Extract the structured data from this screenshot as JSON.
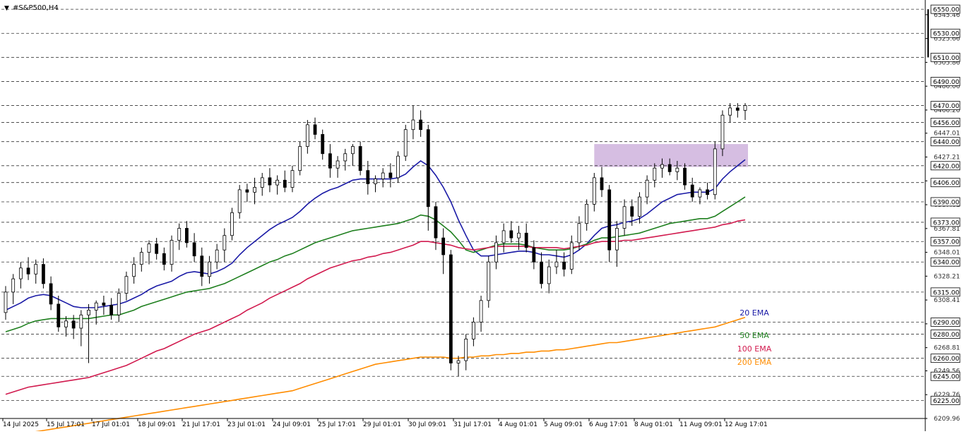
{
  "window": {
    "title": "#S&P500,H4",
    "title_icon": "triangle-down-icon"
  },
  "chart_data": {
    "type": "candlestick",
    "symbol": "#S&P500",
    "timeframe": "H4",
    "ylim": [
      6209.96,
      6553
    ],
    "price_labels_boxed": [
      6550.0,
      6530.0,
      6510.0,
      6490.0,
      6470.0,
      6456.0,
      6440.0,
      6420.0,
      6406.0,
      6390.0,
      6373.0,
      6357.0,
      6340.0,
      6315.0,
      6290.0,
      6280.0,
      6260.0,
      6245.0,
      6225.0
    ],
    "price_labels_plain": [
      "6545.46",
      "6525.66",
      "6505.86",
      "6486.06",
      "6466.26",
      "6447.01",
      "6427.21",
      "6407.41",
      "6387.61",
      "6367.81",
      "6348.01",
      "6328.21",
      "6308.41",
      "6288.61",
      "6268.81",
      "6249.56",
      "6229.76",
      "6209.96"
    ],
    "level_lines": [
      6550,
      6530,
      6510,
      6490,
      6470,
      6456,
      6440,
      6420,
      6406,
      6390,
      6373,
      6357,
      6340,
      6315,
      6290,
      6280,
      6260,
      6245,
      6225
    ],
    "x_labels": [
      "14 Jul 2025",
      "15 Jul 17:01",
      "17 Jul 01:01",
      "18 Jul 09:01",
      "21 Jul 17:01",
      "23 Jul 01:01",
      "24 Jul 09:01",
      "25 Jul 17:01",
      "29 Jul 01:01",
      "30 Jul 09:01",
      "31 Jul 17:01",
      "4 Aug 01:01",
      "5 Aug 09:01",
      "6 Aug 17:01",
      "8 Aug 01:01",
      "11 Aug 09:01",
      "12 Aug 17:01"
    ],
    "candles": [
      [
        6298,
        6320,
        6292,
        6315
      ],
      [
        6315,
        6330,
        6305,
        6326
      ],
      [
        6326,
        6340,
        6318,
        6335
      ],
      [
        6335,
        6344,
        6325,
        6330
      ],
      [
        6330,
        6342,
        6322,
        6338
      ],
      [
        6338,
        6343,
        6318,
        6322
      ],
      [
        6322,
        6328,
        6300,
        6305
      ],
      [
        6305,
        6312,
        6282,
        6286
      ],
      [
        6286,
        6295,
        6278,
        6291
      ],
      [
        6291,
        6296,
        6276,
        6285
      ],
      [
        6285,
        6300,
        6270,
        6296
      ],
      [
        6296,
        6305,
        6256,
        6300
      ],
      [
        6300,
        6308,
        6288,
        6306
      ],
      [
        6306,
        6312,
        6296,
        6304
      ],
      [
        6304,
        6310,
        6292,
        6296
      ],
      [
        6296,
        6318,
        6290,
        6314
      ],
      [
        6314,
        6332,
        6308,
        6328
      ],
      [
        6328,
        6344,
        6322,
        6338
      ],
      [
        6338,
        6352,
        6332,
        6348
      ],
      [
        6348,
        6358,
        6338,
        6355
      ],
      [
        6355,
        6360,
        6342,
        6347
      ],
      [
        6347,
        6352,
        6333,
        6338
      ],
      [
        6338,
        6362,
        6332,
        6358
      ],
      [
        6358,
        6372,
        6350,
        6368
      ],
      [
        6368,
        6374,
        6352,
        6356
      ],
      [
        6356,
        6364,
        6340,
        6345
      ],
      [
        6345,
        6352,
        6320,
        6328
      ],
      [
        6328,
        6345,
        6322,
        6340
      ],
      [
        6340,
        6355,
        6334,
        6350
      ],
      [
        6350,
        6368,
        6340,
        6362
      ],
      [
        6362,
        6385,
        6358,
        6381
      ],
      [
        6381,
        6404,
        6376,
        6400
      ],
      [
        6400,
        6405,
        6390,
        6398
      ],
      [
        6398,
        6410,
        6388,
        6402
      ],
      [
        6402,
        6414,
        6395,
        6410
      ],
      [
        6410,
        6418,
        6398,
        6404
      ],
      [
        6404,
        6412,
        6396,
        6408
      ],
      [
        6408,
        6416,
        6398,
        6402
      ],
      [
        6402,
        6420,
        6398,
        6416
      ],
      [
        6416,
        6440,
        6412,
        6436
      ],
      [
        6436,
        6458,
        6430,
        6454
      ],
      [
        6454,
        6460,
        6442,
        6446
      ],
      [
        6446,
        6450,
        6425,
        6430
      ],
      [
        6430,
        6438,
        6410,
        6418
      ],
      [
        6418,
        6428,
        6410,
        6424
      ],
      [
        6424,
        6434,
        6416,
        6430
      ],
      [
        6430,
        6438,
        6420,
        6436
      ],
      [
        6436,
        6440,
        6412,
        6416
      ],
      [
        6416,
        6424,
        6396,
        6405
      ],
      [
        6405,
        6412,
        6398,
        6409
      ],
      [
        6409,
        6418,
        6402,
        6414
      ],
      [
        6414,
        6422,
        6402,
        6410
      ],
      [
        6410,
        6432,
        6406,
        6428
      ],
      [
        6428,
        6454,
        6424,
        6450
      ],
      [
        6450,
        6470,
        6442,
        6458
      ],
      [
        6458,
        6466,
        6444,
        6450
      ],
      [
        6450,
        6454,
        6366,
        6386
      ],
      [
        6386,
        6390,
        6350,
        6360
      ],
      [
        6360,
        6368,
        6330,
        6346
      ],
      [
        6346,
        6350,
        6250,
        6256
      ],
      [
        6256,
        6262,
        6245,
        6258
      ],
      [
        6258,
        6280,
        6250,
        6276
      ],
      [
        6276,
        6294,
        6270,
        6290
      ],
      [
        6290,
        6312,
        6282,
        6308
      ],
      [
        6308,
        6345,
        6302,
        6340
      ],
      [
        6340,
        6362,
        6334,
        6356
      ],
      [
        6356,
        6372,
        6348,
        6366
      ],
      [
        6366,
        6374,
        6356,
        6360
      ],
      [
        6360,
        6370,
        6350,
        6364
      ],
      [
        6364,
        6372,
        6348,
        6352
      ],
      [
        6352,
        6358,
        6334,
        6340
      ],
      [
        6340,
        6348,
        6318,
        6322
      ],
      [
        6322,
        6342,
        6314,
        6336
      ],
      [
        6336,
        6350,
        6330,
        6340
      ],
      [
        6340,
        6348,
        6328,
        6334
      ],
      [
        6334,
        6362,
        6330,
        6356
      ],
      [
        6356,
        6378,
        6350,
        6372
      ],
      [
        6372,
        6392,
        6366,
        6388
      ],
      [
        6388,
        6414,
        6382,
        6410
      ],
      [
        6410,
        6419,
        6394,
        6400
      ],
      [
        6400,
        6404,
        6340,
        6350
      ],
      [
        6350,
        6374,
        6336,
        6368
      ],
      [
        6368,
        6392,
        6362,
        6386
      ],
      [
        6386,
        6392,
        6370,
        6378
      ],
      [
        6378,
        6398,
        6372,
        6394
      ],
      [
        6394,
        6412,
        6388,
        6408
      ],
      [
        6408,
        6422,
        6402,
        6418
      ],
      [
        6418,
        6426,
        6410,
        6421
      ],
      [
        6421,
        6426,
        6412,
        6415
      ],
      [
        6415,
        6424,
        6408,
        6418
      ],
      [
        6418,
        6422,
        6400,
        6404
      ],
      [
        6404,
        6410,
        6390,
        6394
      ],
      [
        6394,
        6402,
        6388,
        6400
      ],
      [
        6400,
        6406,
        6392,
        6396
      ],
      [
        6396,
        6440,
        6392,
        6434
      ],
      [
        6434,
        6466,
        6428,
        6462
      ],
      [
        6462,
        6472,
        6456,
        6468
      ],
      [
        6468,
        6472,
        6460,
        6466
      ],
      [
        6466,
        6472,
        6458,
        6470
      ]
    ],
    "ema_legend": [
      {
        "name": "20 EMA",
        "color": "#1a1aa6"
      },
      {
        "name": "50 EMA",
        "color": "#1e7f1e"
      },
      {
        "name": "100 EMA",
        "color": "#d11a4e"
      },
      {
        "name": "200 EMA",
        "color": "#ff8c00"
      }
    ],
    "series": [
      {
        "name": "20 EMA",
        "color": "#1a1aa6",
        "values": [
          6300,
          6303,
          6306,
          6310,
          6312,
          6313,
          6312,
          6309,
          6306,
          6303,
          6302,
          6302,
          6302,
          6303,
          6304,
          6305,
          6307,
          6310,
          6313,
          6317,
          6320,
          6322,
          6324,
          6328,
          6331,
          6332,
          6331,
          6330,
          6332,
          6335,
          6339,
          6346,
          6352,
          6357,
          6362,
          6367,
          6371,
          6374,
          6377,
          6382,
          6388,
          6393,
          6397,
          6400,
          6402,
          6405,
          6408,
          6409,
          6409,
          6409,
          6409,
          6409,
          6410,
          6413,
          6419,
          6424,
          6420,
          6412,
          6402,
          6390,
          6375,
          6362,
          6350,
          6345,
          6345,
          6346,
          6347,
          6348,
          6349,
          6349,
          6348,
          6346,
          6346,
          6345,
          6344,
          6346,
          6350,
          6355,
          6362,
          6368,
          6370,
          6371,
          6373,
          6374,
          6376,
          6380,
          6385,
          6390,
          6393,
          6396,
          6397,
          6398,
          6398,
          6398,
          6401,
          6409,
          6415,
          6420,
          6425
        ]
      },
      {
        "name": "50 EMA",
        "color": "#1e7f1e",
        "values": [
          6282,
          6284,
          6286,
          6289,
          6291,
          6292,
          6293,
          6293,
          6293,
          6293,
          6293,
          6293,
          6294,
          6295,
          6296,
          6296,
          6298,
          6300,
          6303,
          6305,
          6307,
          6309,
          6311,
          6313,
          6315,
          6316,
          6317,
          6318,
          6320,
          6322,
          6325,
          6328,
          6331,
          6334,
          6337,
          6340,
          6342,
          6345,
          6347,
          6350,
          6353,
          6356,
          6358,
          6360,
          6362,
          6364,
          6366,
          6367,
          6368,
          6369,
          6370,
          6371,
          6372,
          6374,
          6376,
          6379,
          6378,
          6375,
          6370,
          6365,
          6358,
          6350,
          6348,
          6350,
          6352,
          6354,
          6355,
          6355,
          6355,
          6354,
          6352,
          6351,
          6350,
          6350,
          6350,
          6351,
          6353,
          6355,
          6358,
          6360,
          6360,
          6361,
          6362,
          6363,
          6364,
          6366,
          6368,
          6370,
          6372,
          6373,
          6374,
          6375,
          6376,
          6376,
          6378,
          6382,
          6386,
          6390,
          6394
        ]
      },
      {
        "name": "100 EMA",
        "color": "#d11a4e",
        "values": [
          6230,
          6232,
          6234,
          6236,
          6237,
          6238,
          6239,
          6240,
          6241,
          6242,
          6243,
          6244,
          6246,
          6248,
          6250,
          6252,
          6254,
          6257,
          6260,
          6263,
          6266,
          6268,
          6271,
          6274,
          6277,
          6280,
          6282,
          6284,
          6287,
          6290,
          6293,
          6296,
          6300,
          6303,
          6306,
          6310,
          6313,
          6316,
          6319,
          6322,
          6326,
          6329,
          6332,
          6335,
          6337,
          6339,
          6341,
          6342,
          6344,
          6345,
          6347,
          6348,
          6350,
          6352,
          6354,
          6357,
          6357,
          6356,
          6355,
          6354,
          6352,
          6351,
          6350,
          6351,
          6352,
          6353,
          6353,
          6353,
          6353,
          6353,
          6352,
          6352,
          6352,
          6352,
          6351,
          6352,
          6353,
          6354,
          6356,
          6357,
          6357,
          6357,
          6358,
          6358,
          6359,
          6360,
          6361,
          6362,
          6363,
          6364,
          6365,
          6366,
          6367,
          6368,
          6369,
          6371,
          6372,
          6374,
          6375
        ]
      },
      {
        "name": "200 EMA",
        "color": "#ff8c00",
        "values": [
          6195,
          6196,
          6197,
          6198,
          6199,
          6200,
          6201,
          6202,
          6203,
          6204,
          6205,
          6206,
          6207,
          6208,
          6209,
          6210,
          6211,
          6212,
          6213,
          6214,
          6215,
          6216,
          6217,
          6218,
          6219,
          6220,
          6221,
          6222,
          6223,
          6224,
          6225,
          6226,
          6227,
          6228,
          6229,
          6230,
          6231,
          6232,
          6233,
          6235,
          6237,
          6239,
          6241,
          6243,
          6245,
          6247,
          6249,
          6251,
          6253,
          6255,
          6256,
          6257,
          6258,
          6259,
          6260,
          6261,
          6261,
          6261,
          6261,
          6260,
          6260,
          6261,
          6261,
          6262,
          6262,
          6263,
          6263,
          6264,
          6264,
          6265,
          6265,
          6266,
          6266,
          6267,
          6267,
          6268,
          6269,
          6270,
          6271,
          6272,
          6273,
          6273,
          6274,
          6275,
          6276,
          6277,
          6278,
          6279,
          6280,
          6281,
          6282,
          6283,
          6284,
          6285,
          6286,
          6288,
          6290,
          6292,
          6294
        ]
      }
    ],
    "zone": {
      "from_index": 78,
      "to_index": 98,
      "low": 6419,
      "high": 6438,
      "color": "#c8a8d8"
    },
    "grid": false,
    "legend_placement": "bottom-right"
  }
}
